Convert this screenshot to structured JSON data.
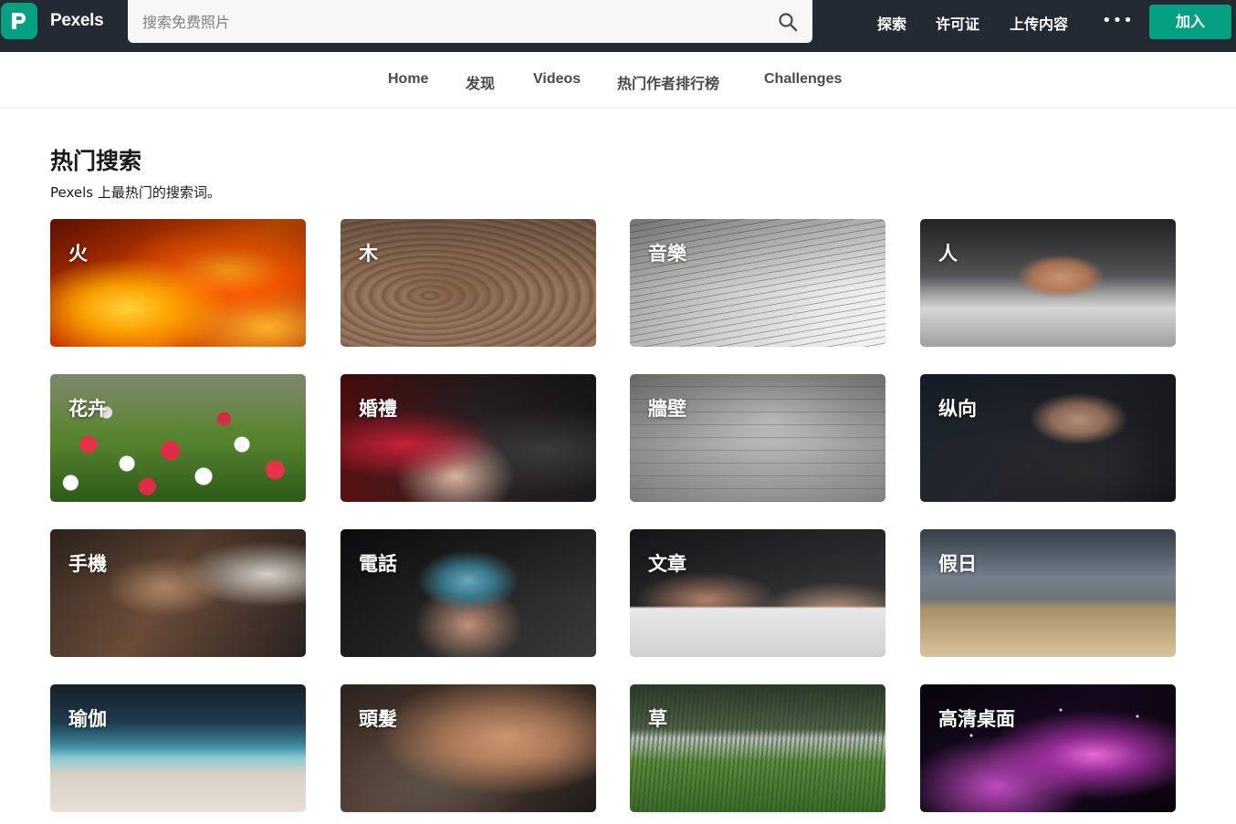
{
  "header": {
    "brand": "Pexels",
    "search_placeholder": "搜索免费照片",
    "nav": [
      "探索",
      "许可证",
      "上传内容"
    ],
    "more_label": "•••",
    "join_label": "加入",
    "accent_color": "#05a081",
    "bar_color": "#232a34"
  },
  "subnav": {
    "items": [
      "Home",
      "发现",
      "Videos",
      "热门作者排行榜",
      "Challenges"
    ]
  },
  "section": {
    "title": "热门搜索",
    "subtitle": "Pexels 上最热门的搜索词。"
  },
  "tiles": [
    {
      "label": "火",
      "image": "fire"
    },
    {
      "label": "木",
      "image": "wood"
    },
    {
      "label": "音樂",
      "image": "music-sheet"
    },
    {
      "label": "人",
      "image": "bearded-man"
    },
    {
      "label": "花卉",
      "image": "flowers"
    },
    {
      "label": "婚禮",
      "image": "champagne-toast"
    },
    {
      "label": "牆壁",
      "image": "brick-wall"
    },
    {
      "label": "纵向",
      "image": "woman-portrait"
    },
    {
      "label": "手機",
      "image": "phone-coffee"
    },
    {
      "label": "電話",
      "image": "iphone-hand"
    },
    {
      "label": "文章",
      "image": "writing-notebook"
    },
    {
      "label": "假日",
      "image": "beach-drink"
    },
    {
      "label": "瑜伽",
      "image": "beach-yoga"
    },
    {
      "label": "頭髮",
      "image": "windblown-hair"
    },
    {
      "label": "草",
      "image": "grass-field"
    },
    {
      "label": "高清桌面",
      "image": "nebula"
    }
  ]
}
